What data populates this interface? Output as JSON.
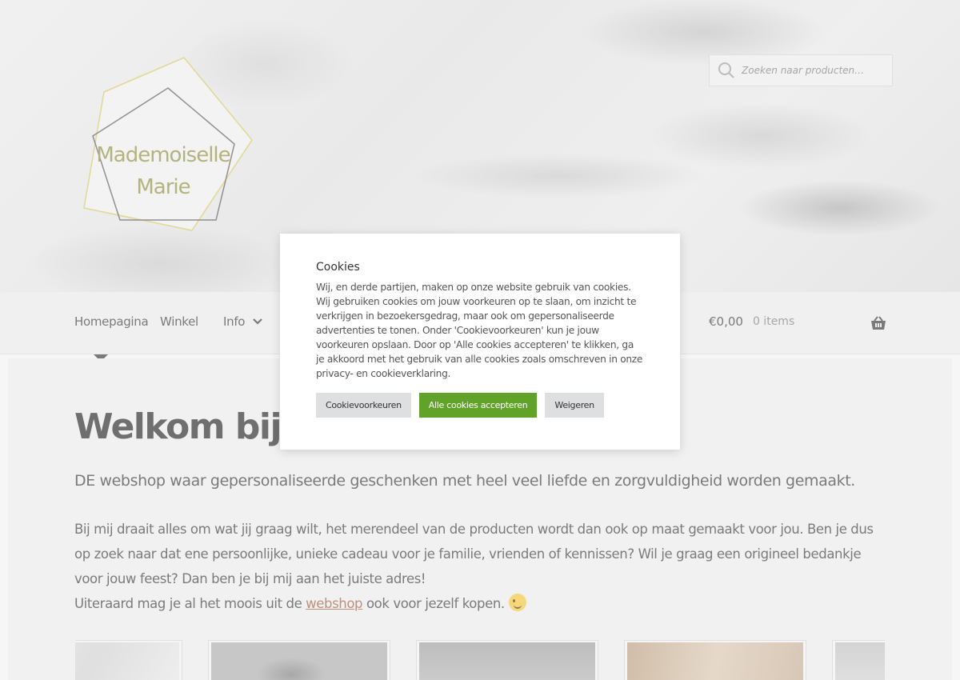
{
  "header": {
    "logo_text_line1": "Mademoiselle",
    "logo_text_line2": "Marie",
    "search_placeholder": "Zoeken naar producten…"
  },
  "nav": {
    "items": [
      "Homepagina",
      "Winkel",
      "Info"
    ],
    "cart_total": "€0,00",
    "cart_count": "0 items"
  },
  "main": {
    "title": "Welkom bij Mademoiselle Marie",
    "subtitle": "DE webshop waar gepersonaliseerde geschenken met heel veel liefde en zorgvuldigheid worden gemaakt.",
    "paragraph_1": "Bij mij draait alles om wat jij graag wilt, het merendeel van de producten wordt dan ook op maat gemaakt voor jou. Ben je dus op zoek naar dat ene persoonlijke, unieke cadeau voor je familie, vrienden of kennissen? Wil je graag een origineel bedankje voor jouw feest? Dan ben je bij mij aan het juiste adres!",
    "paragraph_2_pre": "Uiteraard mag je al het moois uit de ",
    "paragraph_2_link": "webshop",
    "paragraph_2_post": " ook voor jezelf kopen. "
  },
  "cookie": {
    "title": "Cookies",
    "text": "Wij, en derde partijen, maken op onze website gebruik van cookies. Wij gebruiken cookies om jouw voorkeuren op te slaan, om inzicht te verkrijgen in bezoekersgedrag, maar ook om gepersonaliseerde advertenties te tonen. Onder 'Cookievoorkeuren' kun je jouw voorkeuren opslaan. Door op 'Alle cookies accepteren' te klikken, ga je akkoord met het gebruik van alle cookies zoals omschreven in onze privacy- en cookieverklaring.",
    "btn_prefs": "Cookievoorkeuren",
    "btn_accept": "Alle cookies accepteren",
    "btn_reject": "Weigeren"
  },
  "colors": {
    "accept_green": "#61a229",
    "link_brown": "#a0522d",
    "logo_gold": "#d4c25a",
    "logo_text": "#8a8a3a"
  }
}
